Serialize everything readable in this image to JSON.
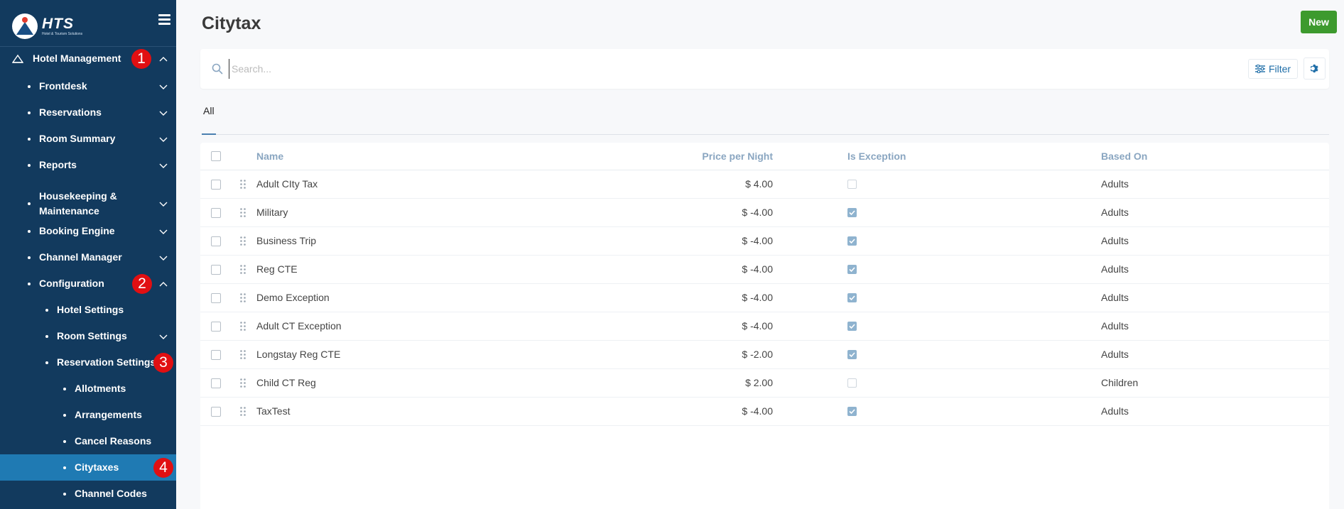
{
  "sidebar": {
    "logo": {
      "brand": "HTS",
      "tagline": "Hotel & Tourism Solutions"
    },
    "items": [
      {
        "label": "Hotel Management",
        "level": 0,
        "chevron": "up",
        "badge": "1"
      },
      {
        "label": "Frontdesk",
        "level": 1,
        "chevron": "down"
      },
      {
        "label": "Reservations",
        "level": 1,
        "chevron": "down"
      },
      {
        "label": "Room Summary",
        "level": 1,
        "chevron": "down"
      },
      {
        "label": "Reports",
        "level": 1,
        "chevron": "down"
      },
      {
        "label": "Housekeeping & Maintenance",
        "level": 1,
        "chevron": "down"
      },
      {
        "label": "Booking Engine",
        "level": 1,
        "chevron": "down"
      },
      {
        "label": "Channel Manager",
        "level": 1,
        "chevron": "down"
      },
      {
        "label": "Configuration",
        "level": 1,
        "chevron": "up",
        "badge": "2"
      },
      {
        "label": "Hotel Settings",
        "level": 2
      },
      {
        "label": "Room Settings",
        "level": 2,
        "chevron": "down"
      },
      {
        "label": "Reservation Settings",
        "level": 2,
        "badge": "3"
      },
      {
        "label": "Allotments",
        "level": 3
      },
      {
        "label": "Arrangements",
        "level": 3
      },
      {
        "label": "Cancel Reasons",
        "level": 3
      },
      {
        "label": "Citytaxes",
        "level": 3,
        "active": true,
        "badge": "4"
      },
      {
        "label": "Channel Codes",
        "level": 3
      }
    ]
  },
  "page": {
    "title": "Citytax",
    "new_label": "New"
  },
  "search": {
    "placeholder": "Search...",
    "value": "",
    "filter_label": "Filter"
  },
  "tabs": [
    {
      "label": "All",
      "active": true
    }
  ],
  "table": {
    "columns": {
      "name": "Name",
      "price": "Price per Night",
      "exception": "Is Exception",
      "based_on": "Based On"
    },
    "rows": [
      {
        "name": "Adult CIty Tax",
        "price": "$ 4.00",
        "is_exception": false,
        "based_on": "Adults"
      },
      {
        "name": "Military",
        "price": "$ -4.00",
        "is_exception": true,
        "based_on": "Adults"
      },
      {
        "name": "Business Trip",
        "price": "$ -4.00",
        "is_exception": true,
        "based_on": "Adults"
      },
      {
        "name": "Reg CTE",
        "price": "$ -4.00",
        "is_exception": true,
        "based_on": "Adults"
      },
      {
        "name": "Demo Exception",
        "price": "$ -4.00",
        "is_exception": true,
        "based_on": "Adults"
      },
      {
        "name": "Adult CT Exception",
        "price": "$ -4.00",
        "is_exception": true,
        "based_on": "Adults"
      },
      {
        "name": "Longstay Reg CTE",
        "price": "$ -2.00",
        "is_exception": true,
        "based_on": "Adults"
      },
      {
        "name": "Child CT Reg",
        "price": "$ 2.00",
        "is_exception": false,
        "based_on": "Children"
      },
      {
        "name": "TaxTest",
        "price": "$ -4.00",
        "is_exception": true,
        "based_on": "Adults"
      }
    ]
  },
  "colors": {
    "sidebar_bg": "#123a5e",
    "sidebar_active": "#1f7ab3",
    "new_button": "#3d9a2e",
    "badge": "#e10f12",
    "accent": "#1f6ea8"
  }
}
